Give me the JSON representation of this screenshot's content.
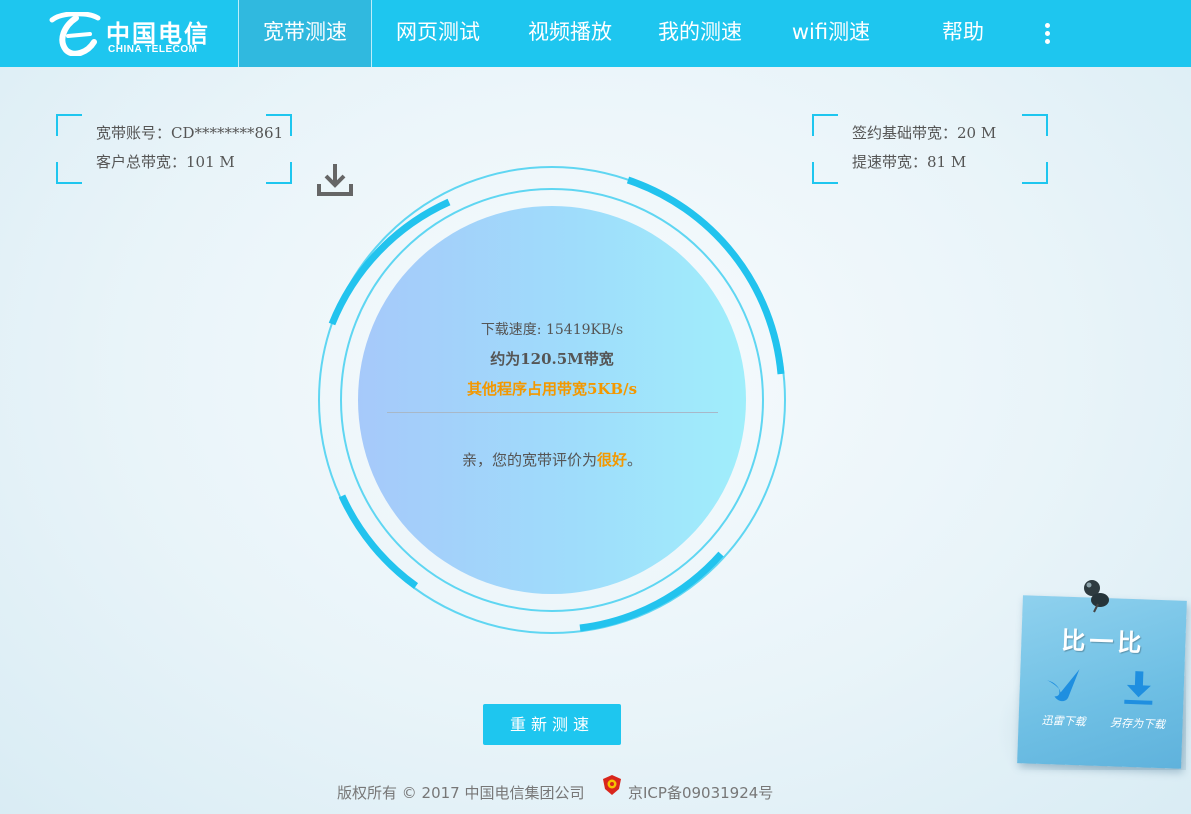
{
  "brand": {
    "name_cn": "中国电信",
    "name_en": "CHINA TELECOM",
    "primary_color": "#1ec6ef",
    "accent_color": "#f39800"
  },
  "nav": {
    "items": [
      {
        "label": "宽带测速",
        "active": true
      },
      {
        "label": "网页测试",
        "active": false
      },
      {
        "label": "视频播放",
        "active": false
      },
      {
        "label": "我的测速",
        "active": false
      },
      {
        "label": "wifi测速",
        "active": false
      },
      {
        "label": "帮助",
        "active": false
      }
    ],
    "more_icon": "more-vertical-icon"
  },
  "account_info": {
    "account": "宽带账号：CD********861",
    "total_bandwidth": "客户总带宽：101 M"
  },
  "plan_info": {
    "base_bandwidth": "签约基础带宽：20 M",
    "boost_bandwidth": "提速带宽：81 M"
  },
  "result": {
    "icon": "download-icon",
    "download_speed": "下载速度: 15419KB/s",
    "approx_bandwidth": "约为120.5M带宽",
    "other_programs": "其他程序占用带宽5KB/s",
    "evaluation_prefix": "亲，您的宽带评价为",
    "evaluation_value": "很好",
    "evaluation_suffix": "。"
  },
  "actions": {
    "retest_label": "重新测速"
  },
  "compare": {
    "title": "比一比",
    "items": [
      {
        "label": "迅雷下载",
        "icon": "thunder-bird-icon"
      },
      {
        "label": "另存为下载",
        "icon": "download-arrow-icon"
      }
    ]
  },
  "footer": {
    "copyright": "版权所有 © 2017 中国电信集团公司",
    "icp": "京ICP备09031924号",
    "police_icon": "police-badge-icon"
  }
}
